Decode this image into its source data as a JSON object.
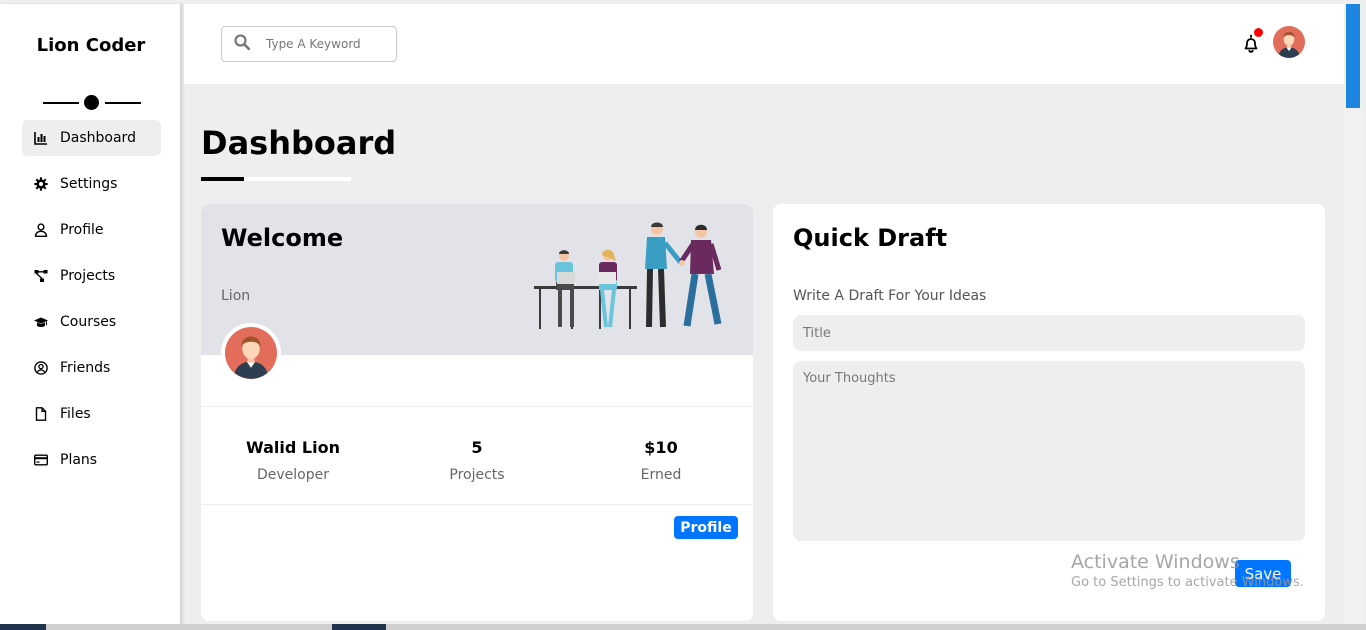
{
  "sidebar": {
    "brand": "Lion Coder",
    "items": [
      {
        "label": "Dashboard",
        "icon": "chart-bar-icon",
        "active": true
      },
      {
        "label": "Settings",
        "icon": "gear-icon",
        "active": false
      },
      {
        "label": "Profile",
        "icon": "user-icon",
        "active": false
      },
      {
        "label": "Projects",
        "icon": "diagram-project-icon",
        "active": false
      },
      {
        "label": "Courses",
        "icon": "graduation-cap-icon",
        "active": false
      },
      {
        "label": "Friends",
        "icon": "user-circle-icon",
        "active": false
      },
      {
        "label": "Files",
        "icon": "file-icon",
        "active": false
      },
      {
        "label": "Plans",
        "icon": "credit-card-icon",
        "active": false
      }
    ]
  },
  "header": {
    "search_placeholder": "Type A Keyword"
  },
  "main": {
    "page_title": "Dashboard"
  },
  "welcome": {
    "title": "Welcome",
    "name": "Lion",
    "stats": [
      {
        "value": "Walid Lion",
        "label": "Developer"
      },
      {
        "value": "5",
        "label": "Projects"
      },
      {
        "value": "$10",
        "label": "Erned"
      }
    ],
    "profile_button": "Profile"
  },
  "draft": {
    "title": "Quick Draft",
    "subtitle": "Write A Draft For Your Ideas",
    "title_placeholder": "Title",
    "thoughts_placeholder": "Your Thoughts",
    "save_button": "Save"
  },
  "watermark": {
    "title": "Activate Windows",
    "subtitle": "Go to Settings to activate Windows."
  },
  "colors": {
    "accent": "#0075ff",
    "background": "#eeeeee",
    "notification_dot": "#ff0000",
    "scrollbar": "#1c86e0"
  }
}
